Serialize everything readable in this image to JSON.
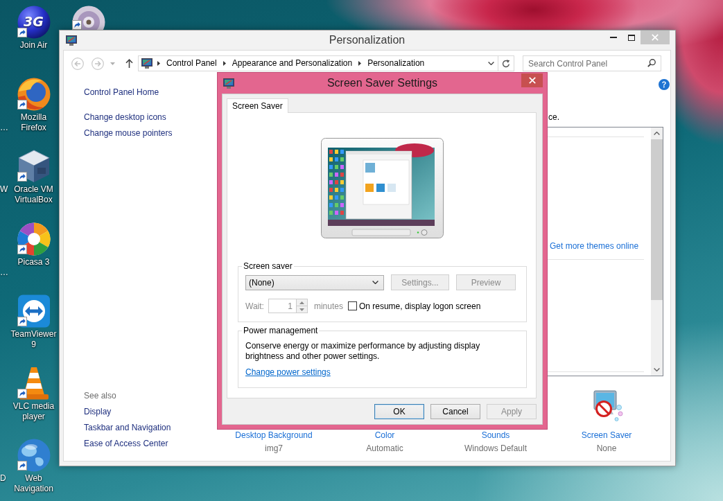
{
  "desktop": {
    "icons": [
      {
        "kind": "sphere",
        "logo_text": "3G",
        "label": "Join Air"
      },
      {
        "kind": "fox",
        "label": "Mozilla Firefox"
      },
      {
        "kind": "cube",
        "label": "Oracle VM VirtualBox"
      },
      {
        "kind": "pinwheel",
        "label": "Picasa 3"
      },
      {
        "kind": "arrows",
        "label": "TeamViewer 9"
      },
      {
        "kind": "cone",
        "label": "VLC media player"
      },
      {
        "kind": "globe",
        "label": "Web Navigation"
      },
      {
        "kind": "disc"
      }
    ],
    "edge_fragments": [
      "…",
      "W",
      "…",
      "D"
    ]
  },
  "window": {
    "title": "Personalization",
    "active": false,
    "breadcrumb": [
      "Control Panel",
      "Appearance and Personalization",
      "Personalization"
    ],
    "search": {
      "placeholder": "Search Control Panel"
    },
    "sidebar": {
      "links": [
        "Control Panel Home",
        "Change desktop icons",
        "Change mouse pointers"
      ],
      "see_also_heading": "See also",
      "see_also": [
        "Display",
        "Taskbar and Navigation",
        "Ease of Access Center"
      ]
    },
    "intro_text": "ce.",
    "themes": {
      "online_link": "Get more themes online"
    },
    "settings": [
      {
        "title": "Desktop Background",
        "value": "img7"
      },
      {
        "title": "Color",
        "value": "Automatic"
      },
      {
        "title": "Sounds",
        "value": "Windows Default"
      },
      {
        "title": "Screen Saver",
        "value": "None"
      }
    ]
  },
  "dialog": {
    "title": "Screen Saver Settings",
    "active": true,
    "tabs": [
      {
        "label": "Screen Saver",
        "selected": true
      }
    ],
    "screen_saver": {
      "legend": "Screen saver",
      "dropdown_value": "(None)",
      "buttons": [
        {
          "label": "Settings...",
          "disabled": true
        },
        {
          "label": "Preview",
          "disabled": true
        }
      ],
      "wait": {
        "label": "Wait:",
        "value": "1",
        "unit": "minutes",
        "disabled": true
      },
      "logon_checkbox": {
        "label": "On resume, display logon screen",
        "checked": false
      }
    },
    "power": {
      "legend": "Power management",
      "text": "Conserve energy or maximize performance by adjusting display brightness and other power settings.",
      "link": "Change power settings"
    },
    "buttons": [
      {
        "label": "OK",
        "default": true,
        "disabled": false
      },
      {
        "label": "Cancel",
        "default": false,
        "disabled": false
      },
      {
        "label": "Apply",
        "default": false,
        "disabled": true
      }
    ]
  }
}
